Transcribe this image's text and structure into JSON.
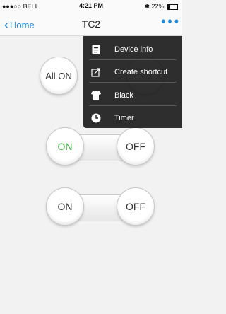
{
  "status": {
    "carrier": "●●●○○ BELL",
    "time": "4:21 PM",
    "battery": "22%"
  },
  "nav": {
    "back_label": "Home",
    "title": "TC2",
    "more": "•••"
  },
  "controls": {
    "all_on": "All ON",
    "rows": [
      {
        "on_label": "ON",
        "off_label": "OFF",
        "state": "on"
      },
      {
        "on_label": "ON",
        "off_label": "OFF",
        "state": "off"
      }
    ]
  },
  "menu": {
    "items": [
      {
        "label": "Device info",
        "icon": "document-icon"
      },
      {
        "label": "Create shortcut",
        "icon": "share-icon"
      },
      {
        "label": "Black",
        "icon": "shirt-icon"
      },
      {
        "label": "Timer",
        "icon": "clock-icon"
      }
    ]
  },
  "colors": {
    "accent": "#1b86d6",
    "on_active": "#3fa63f",
    "menu_bg": "#181818"
  }
}
